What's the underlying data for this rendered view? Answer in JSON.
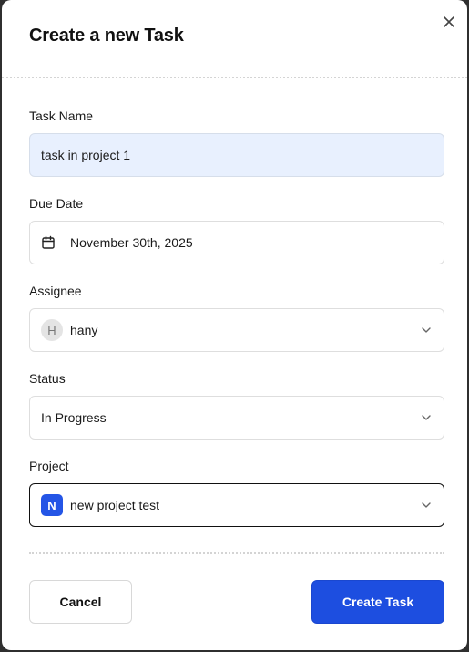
{
  "dialog": {
    "title": "Create a new Task",
    "close_icon": "close-icon"
  },
  "fields": {
    "task_name": {
      "label": "Task Name",
      "value": "task in project 1"
    },
    "due_date": {
      "label": "Due Date",
      "value": "November 30th, 2025",
      "icon": "calendar-icon"
    },
    "assignee": {
      "label": "Assignee",
      "avatar_initial": "H",
      "value": "hany",
      "icon": "chevron-down-icon"
    },
    "status": {
      "label": "Status",
      "value": "In Progress",
      "icon": "chevron-down-icon"
    },
    "project": {
      "label": "Project",
      "badge_initial": "N",
      "value": "new project test",
      "icon": "chevron-down-icon"
    }
  },
  "actions": {
    "cancel_label": "Cancel",
    "create_label": "Create Task"
  },
  "colors": {
    "primary": "#1d4ee0",
    "project_badge": "#2455e6",
    "filled_input_bg": "#e8f0fe",
    "overlay": "#2f2f2f"
  }
}
